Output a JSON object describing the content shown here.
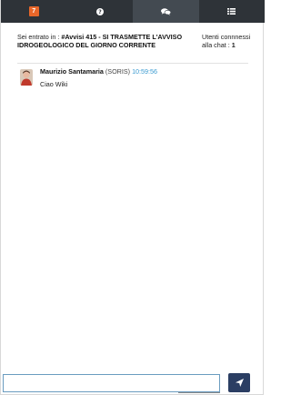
{
  "tabs": [
    {
      "icon": "notification-badge",
      "badge": "7"
    },
    {
      "icon": "help-circle-icon"
    },
    {
      "icon": "chat-bubbles-icon",
      "active": true
    },
    {
      "icon": "list-icon"
    }
  ],
  "header": {
    "prefix": "Sei entrato in : ",
    "room": "#Avvisi 415 - SI TRASMETTE L'AVVISO IDROGEOLOGICO DEL GIORNO CORRENTE",
    "users_label": "Utenti connnessi alla chat : ",
    "users_count": "1"
  },
  "messages": [
    {
      "author": "Maurizio Santamaria",
      "org": "(SORIS)",
      "time": "10:59:56",
      "text": "Ciao Wiki"
    }
  ],
  "input": {
    "value": "",
    "placeholder": ""
  },
  "colors": {
    "topbar": "#2e3338",
    "active_tab": "#434a51",
    "badge": "#e8672a",
    "send": "#2b3e63",
    "time": "#3a9ad0"
  }
}
